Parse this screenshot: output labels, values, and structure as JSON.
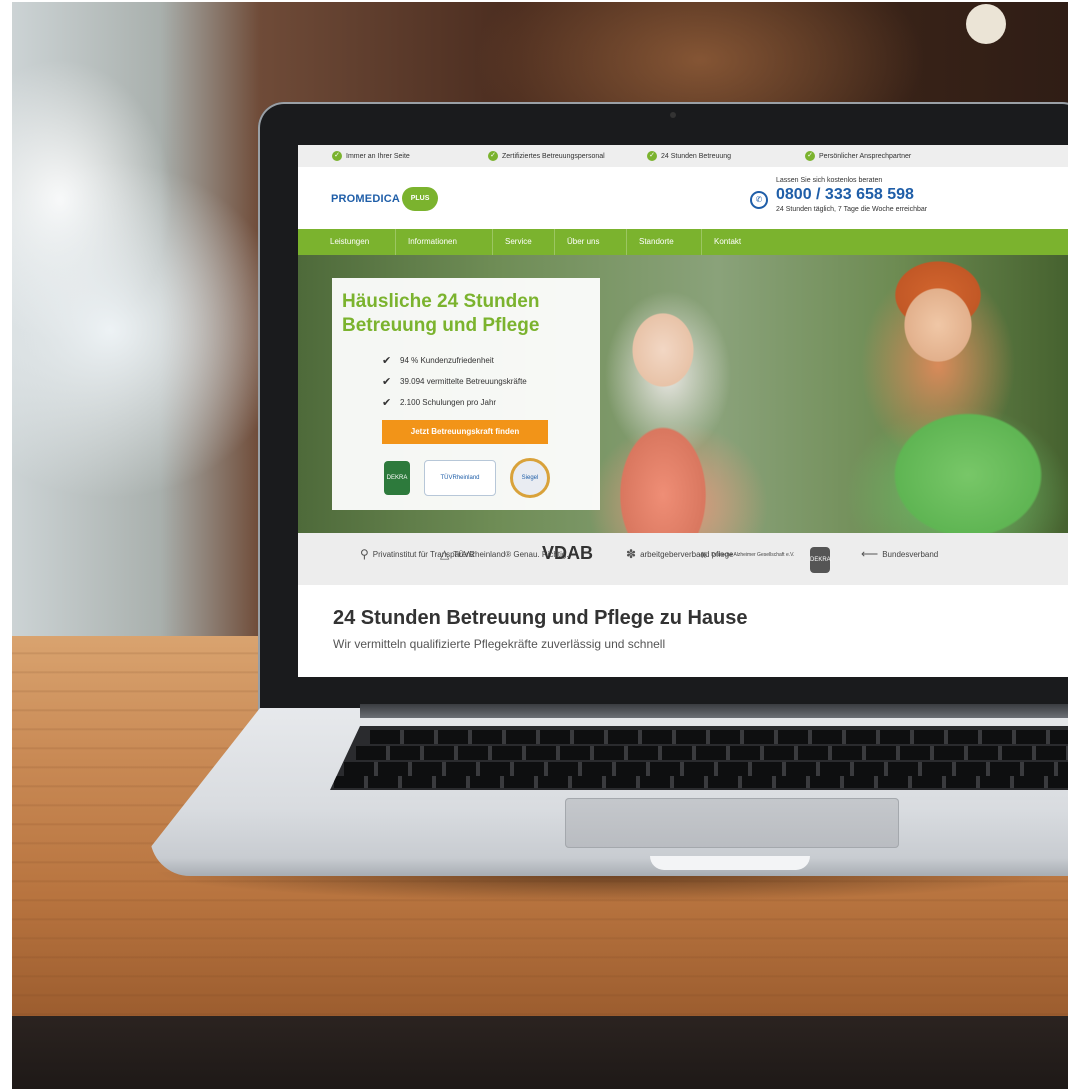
{
  "topbar": {
    "items": [
      {
        "label": "Immer an Ihrer Seite"
      },
      {
        "label": "Zertifiziertes Betreuungspersonal"
      },
      {
        "label": "24 Stunden Betreuung"
      },
      {
        "label": "Persönlicher Ansprechpartner"
      }
    ]
  },
  "header": {
    "logo_text": "PROMEDICA",
    "logo_badge": "PLUS",
    "phone_intro": "Lassen Sie sich kostenlos beraten",
    "phone_number": "0800 / 333 658 598",
    "phone_hours": "24 Stunden täglich, 7 Tage die Woche erreichbar"
  },
  "nav": {
    "items": [
      {
        "label": "Leistungen"
      },
      {
        "label": "Informationen"
      },
      {
        "label": "Service"
      },
      {
        "label": "Über uns"
      },
      {
        "label": "Standorte"
      },
      {
        "label": "Kontakt"
      }
    ]
  },
  "hero": {
    "title": "Häusliche 24 Stunden Betreuung und Pflege",
    "bullets": [
      {
        "text": "94 % Kundenzufriedenheit"
      },
      {
        "text": "39.094 vermittelte Betreuungskräfte"
      },
      {
        "text": "2.100 Schulungen pro Jahr"
      }
    ],
    "cta_label": "Jetzt Betreuungskraft finden",
    "certs": [
      "DEKRA",
      "TÜVRheinland",
      "Siegel"
    ]
  },
  "partners": [
    {
      "label": "Privatinstitut für Transparenz"
    },
    {
      "label": "TÜVRheinland® Genau. Richtig."
    },
    {
      "label": "VDAB"
    },
    {
      "label": "arbeitgeberverband pflege"
    },
    {
      "label": "Deutsche Alzheimer Gesellschaft e.V."
    },
    {
      "label": "DEKRA"
    },
    {
      "label": "Bundesverband"
    }
  ],
  "intro": {
    "title": "24 Stunden Betreuung und Pflege zu Hause",
    "subtitle": "Wir vermitteln qualifizierte Pflegekräfte zuverlässig und schnell"
  },
  "colors": {
    "brand_green": "#7bb32e",
    "brand_blue": "#1f5ea8",
    "cta_orange": "#f29418"
  }
}
